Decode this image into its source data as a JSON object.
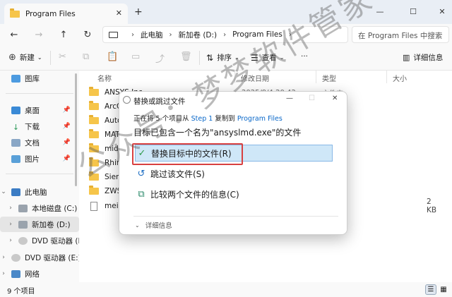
{
  "window": {
    "tab_title": "Program Files",
    "tab_close": "✕",
    "new_tab": "+",
    "controls": [
      "—",
      "☐",
      "✕"
    ]
  },
  "nav": {
    "back": "←",
    "forward": "→",
    "up": "↑",
    "refresh": "↻",
    "breadcrumb": [
      "此电脑",
      "新加卷 (D:)",
      "Program Files"
    ],
    "search_placeholder": "在 Program Files 中搜索"
  },
  "toolbar": {
    "new_label": "新建",
    "sort_label": "排序",
    "view_label": "查看",
    "more_label": "···",
    "details_label": "详细信息"
  },
  "sidebar": {
    "items": [
      {
        "label": "图库",
        "icon": "gallery-icon"
      },
      {
        "label": "桌面",
        "icon": "desktop-icon",
        "pinned": true
      },
      {
        "label": "下载",
        "icon": "download-icon",
        "pinned": true
      },
      {
        "label": "文档",
        "icon": "document-icon",
        "pinned": true
      },
      {
        "label": "图片",
        "icon": "pictures-icon",
        "pinned": true
      },
      {
        "label": "此电脑",
        "icon": "computer-icon"
      },
      {
        "label": "本地磁盘 (C:)",
        "icon": "drive-icon"
      },
      {
        "label": "新加卷 (D:)",
        "icon": "drive-icon"
      },
      {
        "label": "DVD 驱动器 (E",
        "icon": "dvd-icon"
      },
      {
        "label": "DVD 驱动器 (E:)",
        "icon": "dvd-icon"
      },
      {
        "label": "网络",
        "icon": "network-icon"
      }
    ]
  },
  "filelist": {
    "columns": [
      "名称",
      "修改日期",
      "类型",
      "大小"
    ],
    "rows": [
      {
        "name": "ANSYS Inc",
        "date": "2025/9/4 20:42",
        "type": "文件夹",
        "size": ""
      },
      {
        "name": "ArcGIS",
        "date": "",
        "type": "",
        "size": ""
      },
      {
        "name": "Autod",
        "date": "",
        "type": "",
        "size": ""
      },
      {
        "name": "MATL",
        "date": "",
        "type": "",
        "size": ""
      },
      {
        "name": "midas",
        "date": "",
        "type": "",
        "size": ""
      },
      {
        "name": "Rhino",
        "date": "",
        "type": "",
        "size": ""
      },
      {
        "name": "Sieme",
        "date": "",
        "type": "",
        "size": ""
      },
      {
        "name": "ZWSC",
        "date": "",
        "type": "",
        "size": ""
      },
      {
        "name": "meiei",
        "date": "",
        "type": "",
        "size": "2 KB"
      }
    ]
  },
  "status": {
    "count": "9 个项目"
  },
  "dialog": {
    "title": "替换或跳过文件",
    "line1_prefix": "正在将 5 个项目从 ",
    "line1_from": "Step 1",
    "line1_mid": " 复制到 ",
    "line1_to": "Program Files",
    "line2": "目标已包含一个名为\"ansyslmd.exe\"的文件",
    "options": [
      {
        "label": "替换目标中的文件(R)",
        "icon": "✓"
      },
      {
        "label": "跳过该文件(S)",
        "icon": "↺"
      },
      {
        "label": "比较两个文件的信息(C)",
        "icon": "⧉"
      }
    ],
    "details_label": "详细信息",
    "close": "✕",
    "minimize": "—",
    "maximize": "☐"
  },
  "watermark": "公众号：梦梦软件管家",
  "colors": {
    "accent": "#0a68c9",
    "folder": "#f6c54a",
    "selection": "#cfe7f8",
    "highlight_border": "#d84040"
  }
}
